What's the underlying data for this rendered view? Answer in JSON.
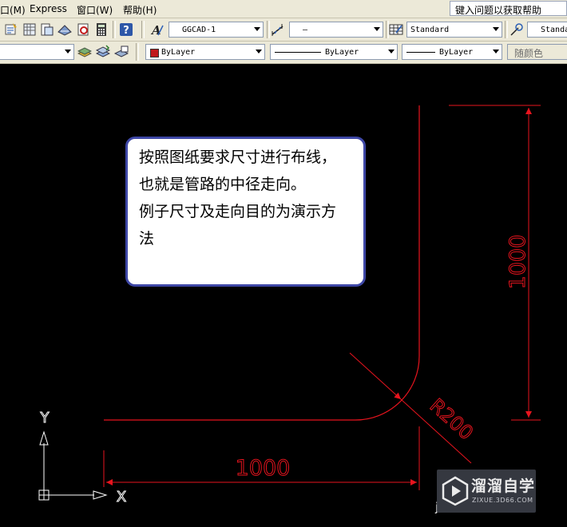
{
  "menubar": {
    "items": [
      {
        "label": "口(M)"
      },
      {
        "label": "Express"
      },
      {
        "label": "窗口(W)"
      },
      {
        "label": "帮助(H)"
      }
    ],
    "help_placeholder": "键入问题以获取帮助"
  },
  "toolbar1": {
    "text_style": "GGCAD-1",
    "dim_style": "—",
    "table_style": "Standard",
    "multileader_style": "Standa"
  },
  "toolbar2": {
    "color": "ByLayer",
    "linetype": "ByLayer",
    "lineweight": "ByLayer",
    "plot_style": "随颜色"
  },
  "drawing": {
    "dim_horizontal": "1000",
    "dim_vertical": "1000",
    "dim_radius": "R200",
    "ucs_x": "X",
    "ucs_y": "Y",
    "cut_text": "j"
  },
  "note": {
    "lines": [
      "按照图纸要求尺寸进行布线，",
      "也就是管路的中径走向。",
      "例子尺寸及走向目的为演示方",
      "法"
    ]
  },
  "watermark": {
    "title": "溜溜自学",
    "url": "ZIXUE.3D66.COM"
  },
  "colors": {
    "dim_red": "#e8141e",
    "bylayer_swatch": "#c0181c",
    "note_border": "#3e47a6"
  }
}
